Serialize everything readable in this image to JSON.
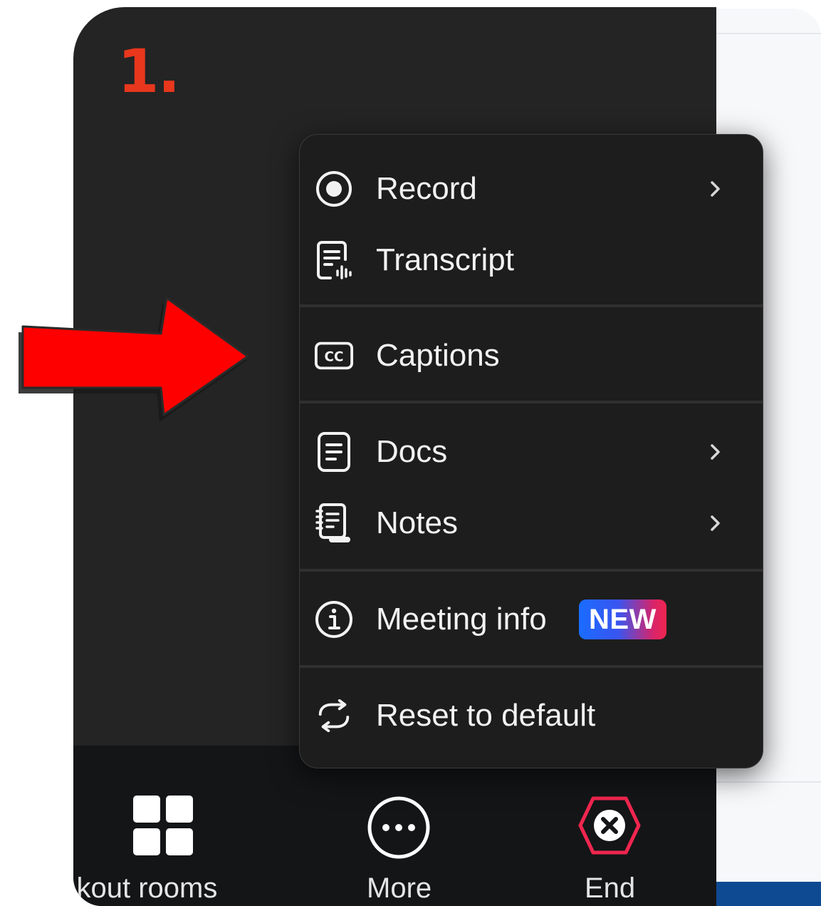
{
  "annotation": {
    "step_label": "1.",
    "arrow_color": "#ff0000",
    "step_color": "#e8371d"
  },
  "menu": {
    "items": [
      {
        "label": "Record",
        "icon": "record-icon",
        "has_submenu": true
      },
      {
        "label": "Transcript",
        "icon": "transcript-icon",
        "has_submenu": false
      },
      {
        "label": "Captions",
        "icon": "cc-icon",
        "has_submenu": false
      },
      {
        "label": "Docs",
        "icon": "docs-icon",
        "has_submenu": true
      },
      {
        "label": "Notes",
        "icon": "notes-icon",
        "has_submenu": true
      },
      {
        "label": "Meeting info",
        "icon": "info-icon",
        "has_submenu": false,
        "badge": "NEW"
      },
      {
        "label": "Reset to default",
        "icon": "reset-icon",
        "has_submenu": false
      }
    ]
  },
  "toolbar": {
    "breakout_label": "eakout rooms",
    "more_label": "More",
    "end_label": "End",
    "end_color": "#f0264f"
  }
}
